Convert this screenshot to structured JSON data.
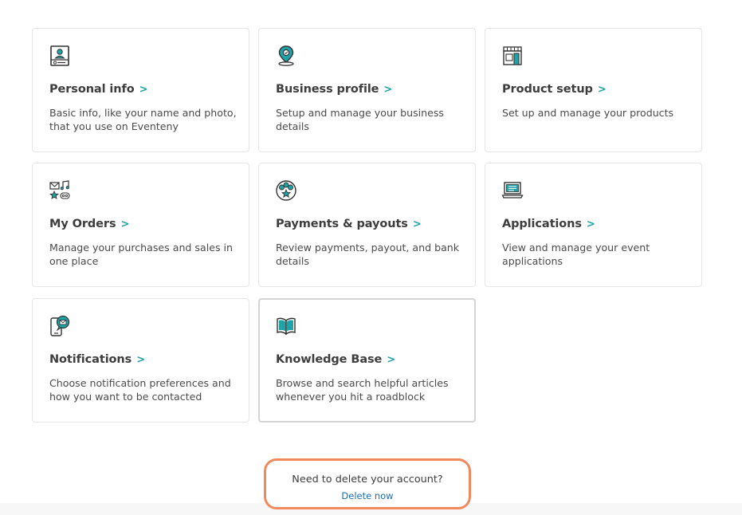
{
  "accent_color": "#1fa3a8",
  "cards": [
    {
      "title": "Personal info",
      "description": "Basic info, like your name and photo, that you use on Eventeny",
      "icon": "id-card-icon"
    },
    {
      "title": "Business profile",
      "description": "Setup and manage your business details",
      "icon": "location-pin-icon"
    },
    {
      "title": "Product setup",
      "description": "Set up and manage your products",
      "icon": "storefront-icon"
    },
    {
      "title": "My Orders",
      "description": "Manage your purchases and sales in one place",
      "icon": "orders-icon"
    },
    {
      "title": "Payments & payouts",
      "description": "Review payments, payout, and bank details",
      "icon": "payments-icon"
    },
    {
      "title": "Applications",
      "description": "View and manage your event applications",
      "icon": "laptop-icon"
    },
    {
      "title": "Notifications",
      "description": "Choose notification preferences and how you want to be contacted",
      "icon": "phone-message-icon"
    },
    {
      "title": "Knowledge Base",
      "description": "Browse and search helpful articles whenever you hit a roadblock",
      "icon": "open-book-icon"
    }
  ],
  "chevron": ">",
  "delete_account": {
    "question": "Need to delete your account?",
    "link_label": "Delete now",
    "highlight_color": "#f08a5d"
  }
}
